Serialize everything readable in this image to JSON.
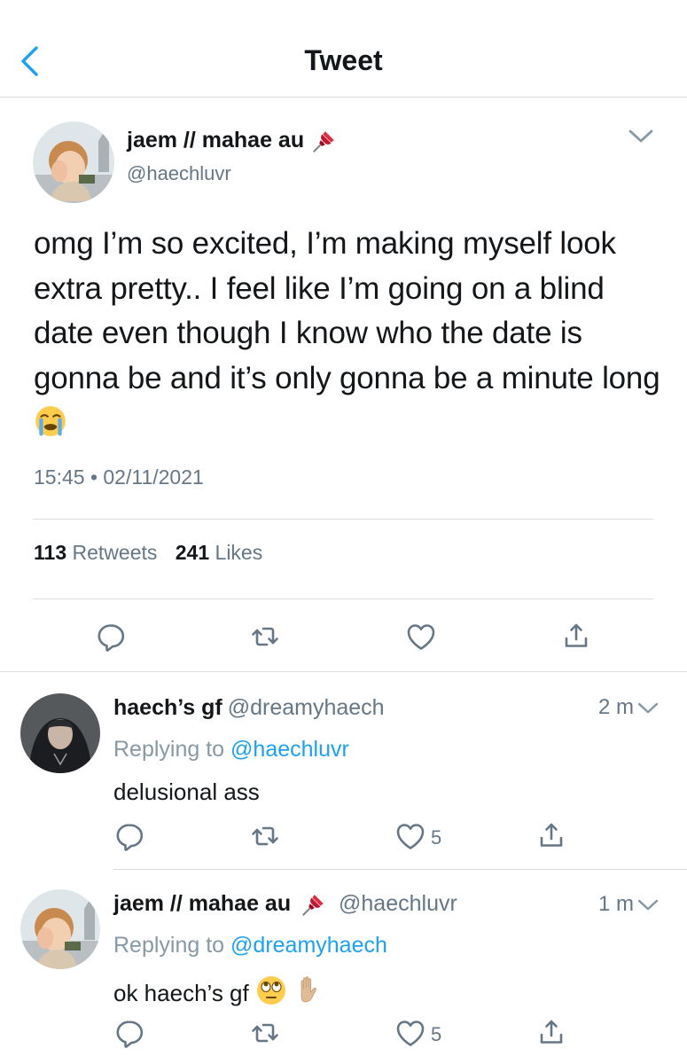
{
  "header": {
    "title": "Tweet"
  },
  "main_tweet": {
    "display_name": "jaem // mahae au",
    "handle": "@haechluvr",
    "text": "omg I’m so excited, I’m making myself look extra pretty.. I feel like I’m going on a blind date even though I know who the date is gonna be and it’s only gonna be a minute long",
    "timestamp": "15:45 • 02/11/2021",
    "retweets_count": "113",
    "retweets_label": "Retweets",
    "likes_count": "241",
    "likes_label": "Likes"
  },
  "replies": [
    {
      "display_name": "haech’s gf",
      "handle": "@dreamyhaech",
      "time": "2 m",
      "replying_prefix": "Replying to",
      "replying_to": "@haechluvr",
      "text": "delusional ass",
      "likes": "5"
    },
    {
      "display_name": "jaem // mahae au",
      "handle": "@haechluvr",
      "time": "1 m",
      "replying_prefix": "Replying to",
      "replying_to": "@dreamyhaech",
      "text": "ok haech’s gf",
      "likes": "5"
    }
  ],
  "icons": {
    "back": "chevron-left-icon",
    "caret": "chevron-down-icon",
    "pin": "pushpin-emoji",
    "crying": "loudly-crying-face-emoji",
    "eye_roll": "face-with-rolling-eyes-emoji",
    "hand": "raised-hand-emoji",
    "reply": "comment-icon",
    "retweet": "retweet-icon",
    "like": "heart-icon",
    "share": "share-icon"
  },
  "colors": {
    "accent": "#1da1f2",
    "secondary_text": "#657786",
    "divider": "#dcdfe2"
  }
}
